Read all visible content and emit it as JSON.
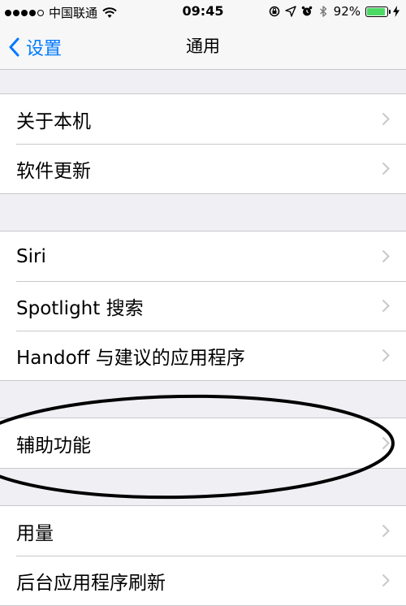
{
  "status_bar": {
    "carrier": "中国联通",
    "time": "09:45",
    "battery_percent": "92%",
    "battery_level": 0.92,
    "signal_bars_filled": 4,
    "signal_bars_total": 5,
    "icons": [
      "wifi-icon",
      "rotation-lock-icon",
      "location-icon",
      "alarm-icon",
      "bluetooth-icon",
      "battery-icon",
      "charging-icon"
    ]
  },
  "nav": {
    "back_label": "设置",
    "title": "通用"
  },
  "groups": [
    {
      "items": [
        {
          "label": "关于本机"
        },
        {
          "label": "软件更新"
        }
      ]
    },
    {
      "items": [
        {
          "label": "Siri"
        },
        {
          "label": "Spotlight 搜索"
        },
        {
          "label": "Handoff 与建议的应用程序"
        }
      ]
    },
    {
      "items": [
        {
          "label": "辅助功能"
        }
      ]
    },
    {
      "items": [
        {
          "label": "用量"
        },
        {
          "label": "后台应用程序刷新"
        }
      ]
    }
  ],
  "colors": {
    "accent": "#007aff",
    "background": "#efeff4",
    "separator": "#c8c7cc",
    "battery_fill": "#4cd964",
    "chevron": "#c7c7cc"
  }
}
